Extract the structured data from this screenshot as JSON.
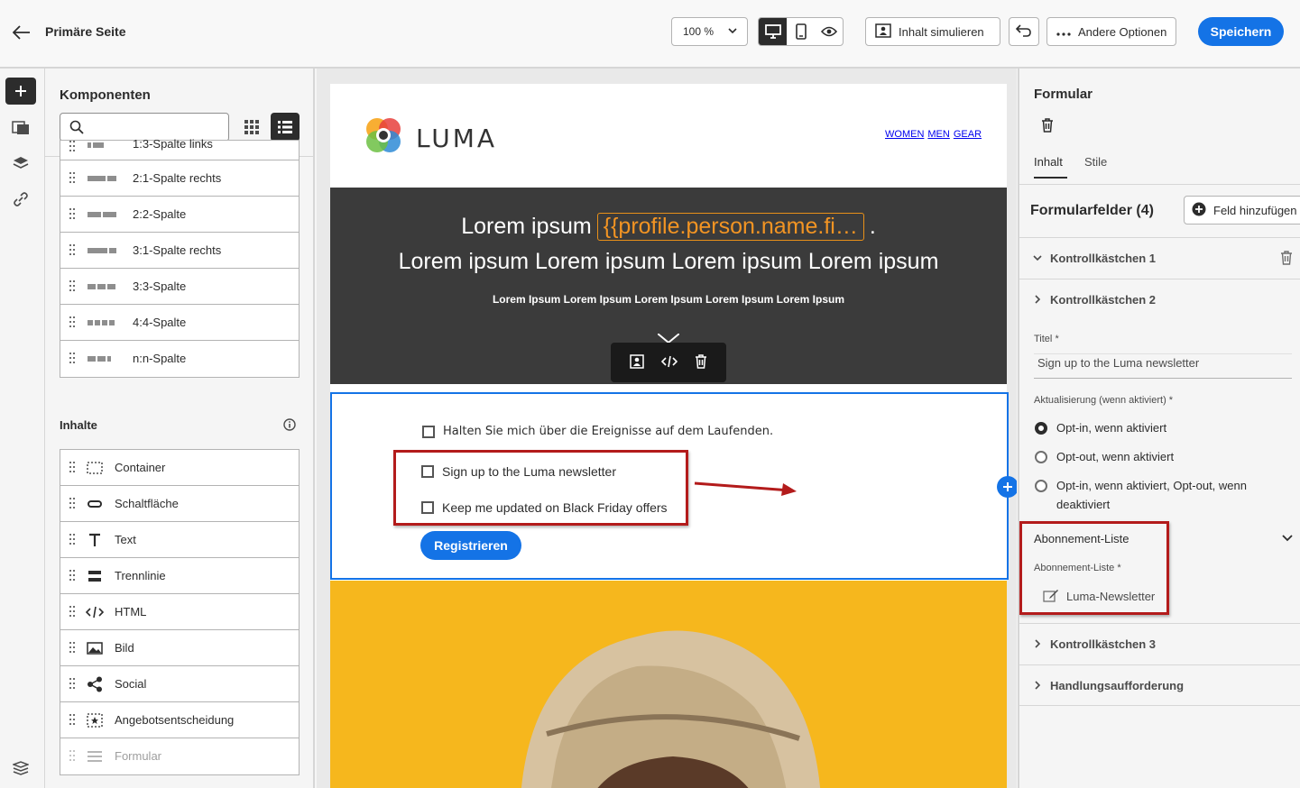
{
  "header": {
    "title": "Primäre Seite",
    "zoom": "100 %",
    "simulate_label": "Inhalt simulieren",
    "options_label": "Andere Optionen",
    "save_label": "Speichern"
  },
  "components": {
    "title": "Komponenten",
    "structures": [
      {
        "label": "1:3-Spalte links",
        "cols": [
          4,
          12
        ]
      },
      {
        "label": "2:1-Spalte rechts",
        "cols": [
          20,
          10
        ]
      },
      {
        "label": "2:2-Spalte",
        "cols": [
          15,
          15
        ]
      },
      {
        "label": "3:1-Spalte rechts",
        "cols": [
          22,
          8
        ]
      },
      {
        "label": "3:3-Spalte",
        "cols": [
          9,
          9,
          9
        ]
      },
      {
        "label": "4:4-Spalte",
        "cols": [
          6,
          6,
          6,
          6
        ]
      },
      {
        "label": "n:n-Spalte",
        "cols": [
          9,
          9,
          4
        ]
      }
    ],
    "content_title": "Inhalte",
    "content_items": [
      {
        "label": "Container",
        "icon": "container-icon"
      },
      {
        "label": "Schaltfläche",
        "icon": "button-icon"
      },
      {
        "label": "Text",
        "icon": "text-icon"
      },
      {
        "label": "Trennlinie",
        "icon": "divider-icon"
      },
      {
        "label": "HTML",
        "icon": "html-icon"
      },
      {
        "label": "Bild",
        "icon": "image-icon"
      },
      {
        "label": "Social",
        "icon": "share-icon"
      },
      {
        "label": "Angebotsentscheidung",
        "icon": "offer-icon"
      },
      {
        "label": "Formular",
        "icon": "form-icon",
        "disabled": true
      }
    ]
  },
  "email": {
    "logo_text": "LUMA",
    "nav": [
      "WOMEN",
      "MEN",
      "GEAR"
    ],
    "hero_prefix": "Lorem ipsum",
    "hero_token": "{{profile.person.name.fi…",
    "hero_suffix": ".",
    "hero_line2": "Lorem ipsum Lorem ipsum Lorem ipsum Lorem ipsum",
    "hero_line3": "Lorem Ipsum Lorem Ipsum Lorem Ipsum Lorem Ipsum Lorem Ipsum",
    "checkbox1": "Halten Sie mich über die Ereignisse auf dem Laufenden.",
    "checkbox2": "Sign up to the Luma newsletter",
    "checkbox3": "Keep me updated on Black Friday offers",
    "register_label": "Registrieren"
  },
  "props": {
    "title": "Formular",
    "tab_content": "Inhalt",
    "tab_styles": "Stile",
    "fields_title": "Formularfelder (4)",
    "add_field_label": "Feld hinzufügen",
    "checkbox1_label": "Kontrollkästchen 1",
    "checkbox2_label": "Kontrollkästchen 2",
    "title_label": "Titel",
    "title_value": "Sign up to the Luma newsletter",
    "update_label": "Aktualisierung (wenn aktiviert)",
    "required_mark": "*",
    "radio_options": [
      "Opt-in, wenn aktiviert",
      "Opt-out, wenn aktiviert",
      "Opt-in, wenn aktiviert, Opt-out, wenn deaktiviert"
    ],
    "radio_selected": 0,
    "subscription_title": "Abonnement-Liste",
    "subscription_label": "Abonnement-Liste",
    "subscription_value": "Luma-Newsletter",
    "checkbox3_label": "Kontrollkästchen 3",
    "cta_label": "Handlungsaufforderung"
  },
  "colors": {
    "accent": "#1473e6",
    "annotation_red": "#b31b1b",
    "token_orange": "#f29423",
    "hero_bg": "#3b3b3b",
    "photo_bg": "#f6b71d"
  }
}
